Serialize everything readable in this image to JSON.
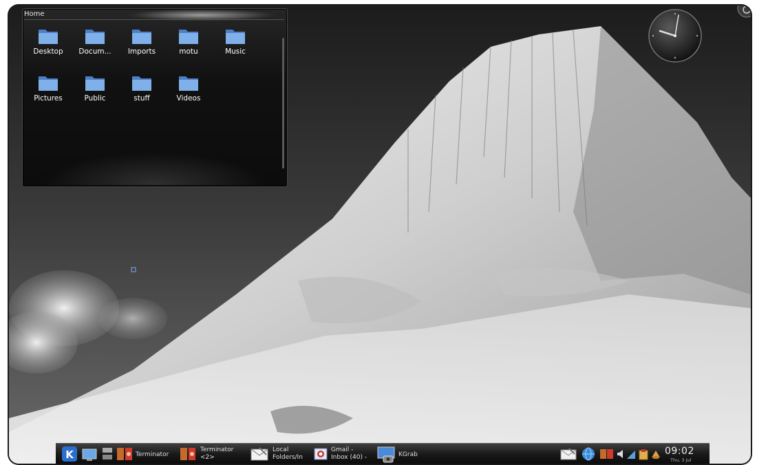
{
  "desktop": {
    "wallpaper": "snow-covered-mountain-peak-grayscale"
  },
  "folderview": {
    "title": "Home",
    "items": [
      {
        "label": "Desktop",
        "icon": "folder-icon"
      },
      {
        "label": "Docum...",
        "icon": "folder-icon"
      },
      {
        "label": "Imports",
        "icon": "folder-icon"
      },
      {
        "label": "motu",
        "icon": "folder-icon"
      },
      {
        "label": "Music",
        "icon": "folder-icon"
      },
      {
        "label": "Pictures",
        "icon": "folder-icon"
      },
      {
        "label": "Public",
        "icon": "folder-icon"
      },
      {
        "label": "stuff",
        "icon": "folder-icon"
      },
      {
        "label": "Videos",
        "icon": "folder-icon"
      }
    ],
    "folder_color": "#6fa0e0"
  },
  "taskbar": {
    "tasks": [
      {
        "label": "Terminator",
        "icon": "terminal-icon"
      },
      {
        "label_line1": "Terminator",
        "label_line2": "<2>",
        "icon": "terminal-icon"
      },
      {
        "label_line1": "Local",
        "label_line2": "Folders/In",
        "icon": "mail-icon"
      },
      {
        "label_line1": "Gmail -",
        "label_line2": "Inbox (40) -",
        "icon": "browser-icon"
      },
      {
        "label": "KGrab",
        "icon": "screenshot-icon"
      }
    ],
    "clock": {
      "time": "09:02",
      "date": "Thu, 3 Jul"
    }
  }
}
